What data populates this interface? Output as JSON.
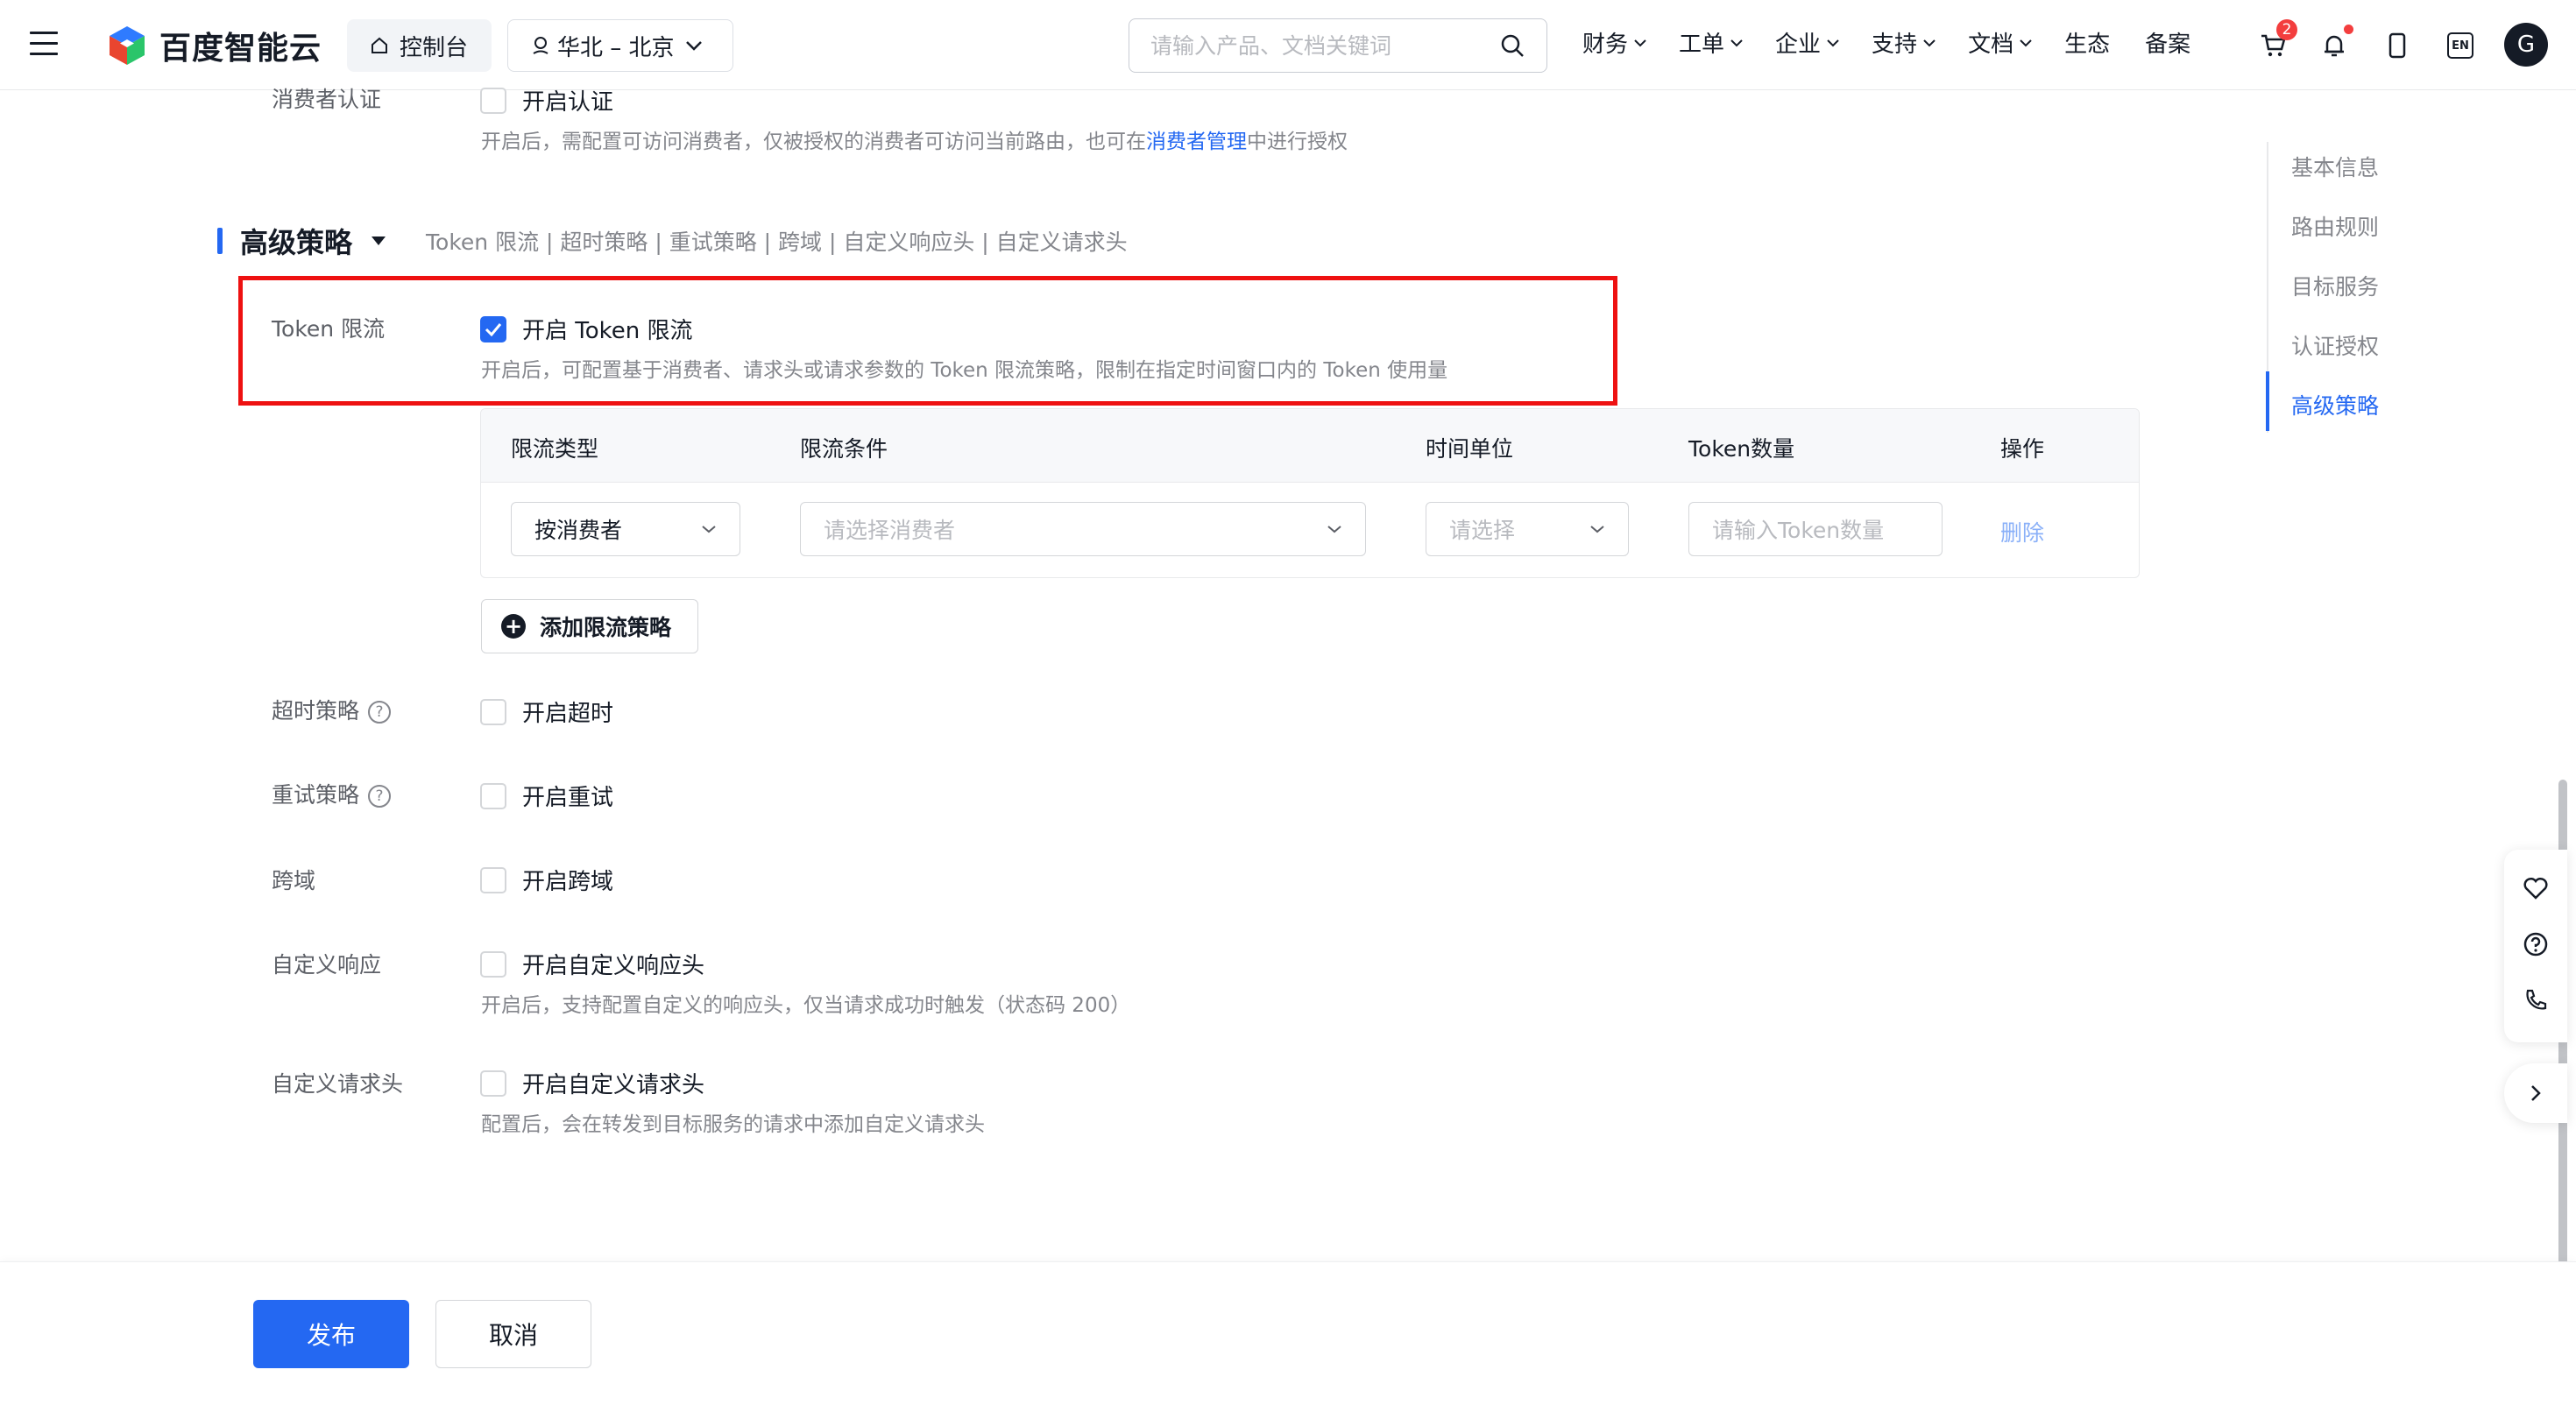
{
  "header": {
    "logo_text": "百度智能云",
    "console_label": "控制台",
    "region_label": "华北 – 北京",
    "search_placeholder": "请输入产品、文档关键词",
    "nav": [
      "财务",
      "工单",
      "企业",
      "支持",
      "文档",
      "生态",
      "备案"
    ],
    "cart_badge": "2",
    "lang_label": "EN",
    "avatar_letter": "G"
  },
  "consumer_auth": {
    "label": "消费者认证",
    "checkbox_label": "开启认证",
    "checked": false,
    "hint_prefix": "开启后，需配置可访问消费者，仅被授权的消费者可访问当前路由，也可在",
    "hint_link": "消费者管理",
    "hint_suffix": "中进行授权"
  },
  "advanced": {
    "title": "高级策略",
    "subtitle": "Token 限流 | 超时策略 | 重试策略 | 跨域 | 自定义响应头 | 自定义请求头"
  },
  "token_limit": {
    "label": "Token 限流",
    "checkbox_label": "开启 Token 限流",
    "checked": true,
    "hint": "开启后，可配置基于消费者、请求头或请求参数的 Token 限流策略，限制在指定时间窗口内的 Token 使用量",
    "table": {
      "headers": [
        "限流类型",
        "限流条件",
        "时间单位",
        "Token数量",
        "操作"
      ],
      "row": {
        "type_value": "按消费者",
        "condition_placeholder": "请选择消费者",
        "time_unit_placeholder": "请选择",
        "token_count_placeholder": "请输入Token数量",
        "action": "删除"
      }
    },
    "add_button": "添加限流策略"
  },
  "timeout": {
    "label": "超时策略",
    "checkbox_label": "开启超时",
    "checked": false
  },
  "retry": {
    "label": "重试策略",
    "checkbox_label": "开启重试",
    "checked": false
  },
  "cors": {
    "label": "跨域",
    "checkbox_label": "开启跨域",
    "checked": false
  },
  "custom_response": {
    "label": "自定义响应",
    "checkbox_label": "开启自定义响应头",
    "checked": false,
    "hint": "开启后，支持配置自定义的响应头，仅当请求成功时触发（状态码 200）"
  },
  "custom_request": {
    "label": "自定义请求头",
    "checkbox_label": "开启自定义请求头",
    "checked": false,
    "hint": "配置后，会在转发到目标服务的请求中添加自定义请求头"
  },
  "anchor_nav": {
    "items": [
      "基本信息",
      "路由规则",
      "目标服务",
      "认证授权",
      "高级策略"
    ],
    "active": "高级策略"
  },
  "footer": {
    "publish_label": "发布",
    "cancel_label": "取消"
  },
  "colors": {
    "primary": "#2468f2",
    "highlight_border": "#ee1111",
    "badge": "#f33e3e"
  }
}
